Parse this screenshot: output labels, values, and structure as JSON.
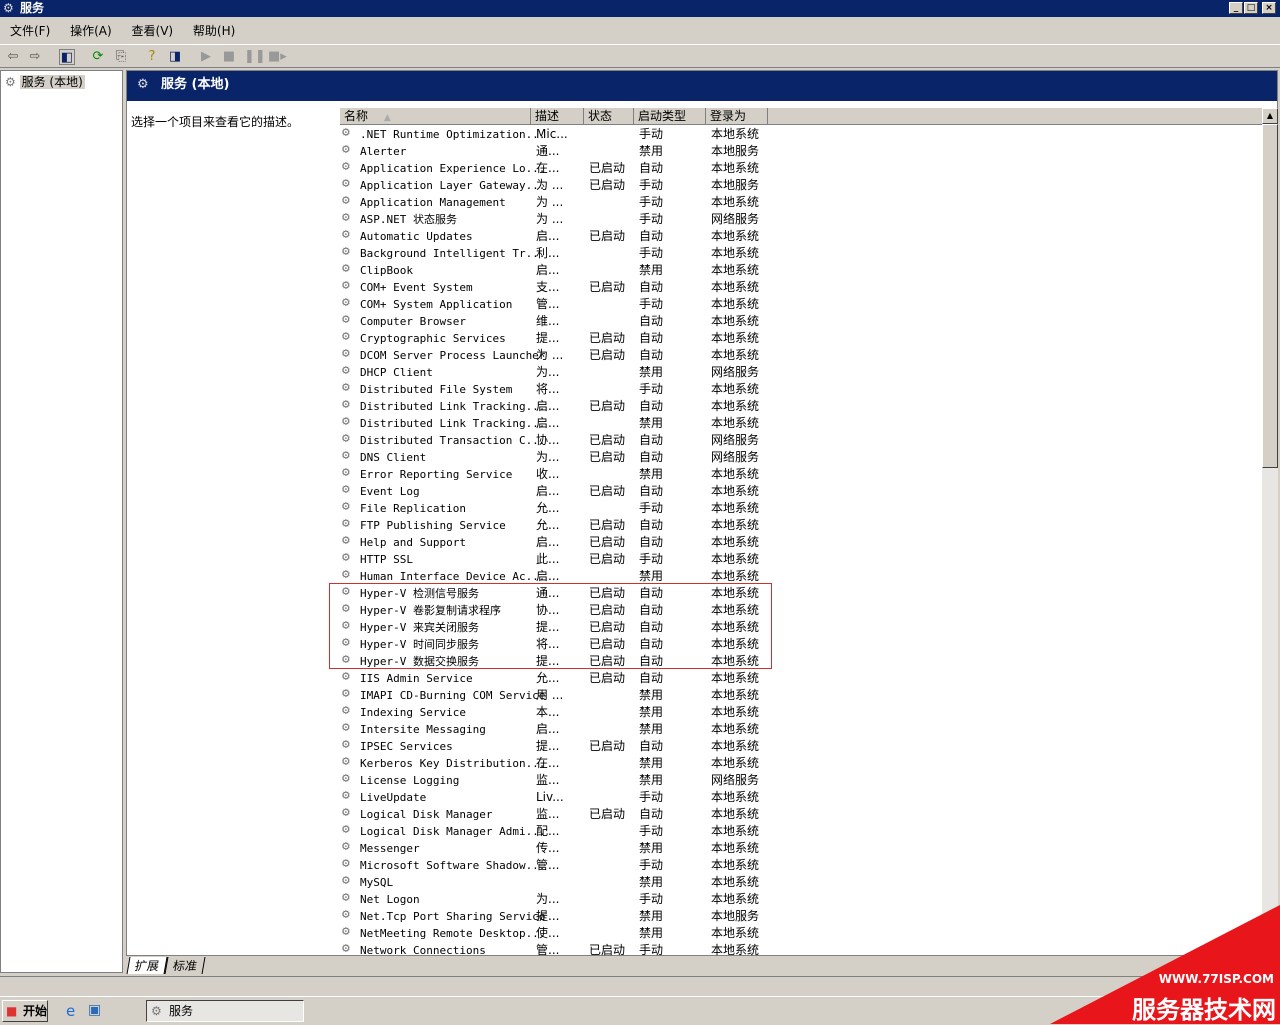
{
  "window": {
    "title": "服务",
    "min": "_",
    "max": "□",
    "close": "×"
  },
  "menu": [
    "文件(F)",
    "操作(A)",
    "查看(V)",
    "帮助(H)"
  ],
  "toolbar": [
    "back-icon",
    "forward-icon",
    "show-hide-tree-icon",
    "refresh-icon",
    "export-list-icon",
    "help-icon",
    "show-hide-action-pane-icon",
    "start-service-icon",
    "stop-service-icon",
    "pause-service-icon",
    "restart-service-icon"
  ],
  "tree": {
    "root": "服务 (本地)"
  },
  "main": {
    "header": "服务 (本地)",
    "description": "选择一个项目来查看它的描述。"
  },
  "columns": [
    "名称",
    "描述",
    "状态",
    "启动类型",
    "登录为"
  ],
  "sort_indicator": "▲",
  "services": [
    [
      ".NET Runtime Optimization...",
      "Mic...",
      "",
      "手动",
      "本地系统"
    ],
    [
      "Alerter",
      "通...",
      "",
      "禁用",
      "本地服务"
    ],
    [
      "Application Experience Lo...",
      "在...",
      "已启动",
      "自动",
      "本地系统"
    ],
    [
      "Application Layer Gateway...",
      "为 ...",
      "已启动",
      "手动",
      "本地服务"
    ],
    [
      "Application Management",
      "为 ...",
      "",
      "手动",
      "本地系统"
    ],
    [
      "ASP.NET 状态服务",
      "为 ...",
      "",
      "手动",
      "网络服务"
    ],
    [
      "Automatic Updates",
      "启...",
      "已启动",
      "自动",
      "本地系统"
    ],
    [
      "Background Intelligent Tr...",
      "利...",
      "",
      "手动",
      "本地系统"
    ],
    [
      "ClipBook",
      "启...",
      "",
      "禁用",
      "本地系统"
    ],
    [
      "COM+ Event System",
      "支...",
      "已启动",
      "自动",
      "本地系统"
    ],
    [
      "COM+ System Application",
      "管...",
      "",
      "手动",
      "本地系统"
    ],
    [
      "Computer Browser",
      "维...",
      "",
      "自动",
      "本地系统"
    ],
    [
      "Cryptographic Services",
      "提...",
      "已启动",
      "自动",
      "本地系统"
    ],
    [
      "DCOM Server Process Launcher",
      "为 ...",
      "已启动",
      "自动",
      "本地系统"
    ],
    [
      "DHCP Client",
      "为...",
      "",
      "禁用",
      "网络服务"
    ],
    [
      "Distributed File System",
      "将...",
      "",
      "手动",
      "本地系统"
    ],
    [
      "Distributed Link Tracking...",
      "启...",
      "已启动",
      "自动",
      "本地系统"
    ],
    [
      "Distributed Link Tracking...",
      "启...",
      "",
      "禁用",
      "本地系统"
    ],
    [
      "Distributed Transaction C...",
      "协...",
      "已启动",
      "自动",
      "网络服务"
    ],
    [
      "DNS Client",
      "为...",
      "已启动",
      "自动",
      "网络服务"
    ],
    [
      "Error Reporting Service",
      "收...",
      "",
      "禁用",
      "本地系统"
    ],
    [
      "Event Log",
      "启...",
      "已启动",
      "自动",
      "本地系统"
    ],
    [
      "File Replication",
      "允...",
      "",
      "手动",
      "本地系统"
    ],
    [
      "FTP Publishing Service",
      "允...",
      "已启动",
      "自动",
      "本地系统"
    ],
    [
      "Help and Support",
      "启...",
      "已启动",
      "自动",
      "本地系统"
    ],
    [
      "HTTP SSL",
      "此...",
      "已启动",
      "手动",
      "本地系统"
    ],
    [
      "Human Interface Device Ac...",
      "启...",
      "",
      "禁用",
      "本地系统"
    ],
    [
      "Hyper-V 检测信号服务",
      "通...",
      "已启动",
      "自动",
      "本地系统"
    ],
    [
      "Hyper-V 卷影复制请求程序",
      "协...",
      "已启动",
      "自动",
      "本地系统"
    ],
    [
      "Hyper-V 来宾关闭服务",
      "提...",
      "已启动",
      "自动",
      "本地系统"
    ],
    [
      "Hyper-V 时间同步服务",
      "将...",
      "已启动",
      "自动",
      "本地系统"
    ],
    [
      "Hyper-V 数据交换服务",
      "提...",
      "已启动",
      "自动",
      "本地系统"
    ],
    [
      "IIS Admin Service",
      "允...",
      "已启动",
      "自动",
      "本地系统"
    ],
    [
      "IMAPI CD-Burning COM Service",
      "用 ...",
      "",
      "禁用",
      "本地系统"
    ],
    [
      "Indexing Service",
      "本...",
      "",
      "禁用",
      "本地系统"
    ],
    [
      "Intersite Messaging",
      "启...",
      "",
      "禁用",
      "本地系统"
    ],
    [
      "IPSEC Services",
      "提...",
      "已启动",
      "自动",
      "本地系统"
    ],
    [
      "Kerberos Key Distribution...",
      "在...",
      "",
      "禁用",
      "本地系统"
    ],
    [
      "License Logging",
      "监...",
      "",
      "禁用",
      "网络服务"
    ],
    [
      "LiveUpdate",
      "Liv...",
      "",
      "手动",
      "本地系统"
    ],
    [
      "Logical Disk Manager",
      "监...",
      "已启动",
      "自动",
      "本地系统"
    ],
    [
      "Logical Disk Manager Admi...",
      "配...",
      "",
      "手动",
      "本地系统"
    ],
    [
      "Messenger",
      "传...",
      "",
      "禁用",
      "本地系统"
    ],
    [
      "Microsoft Software Shadow...",
      "管...",
      "",
      "手动",
      "本地系统"
    ],
    [
      "MySQL",
      "",
      "",
      "禁用",
      "本地系统"
    ],
    [
      "Net Logon",
      "为...",
      "",
      "手动",
      "本地系统"
    ],
    [
      "Net.Tcp Port Sharing Service",
      "提...",
      "",
      "禁用",
      "本地服务"
    ],
    [
      "NetMeeting Remote Desktop...",
      "使...",
      "",
      "禁用",
      "本地系统"
    ],
    [
      "Network Connections",
      "管...",
      "已启动",
      "手动",
      "本地系统"
    ]
  ],
  "highlight_color": "#d03030",
  "tabs": [
    "扩展",
    "标准"
  ],
  "taskbar": {
    "start": "开始",
    "task": "服务"
  },
  "watermark": {
    "url": "WWW.77ISP.COM",
    "name": "服务器技术网"
  }
}
